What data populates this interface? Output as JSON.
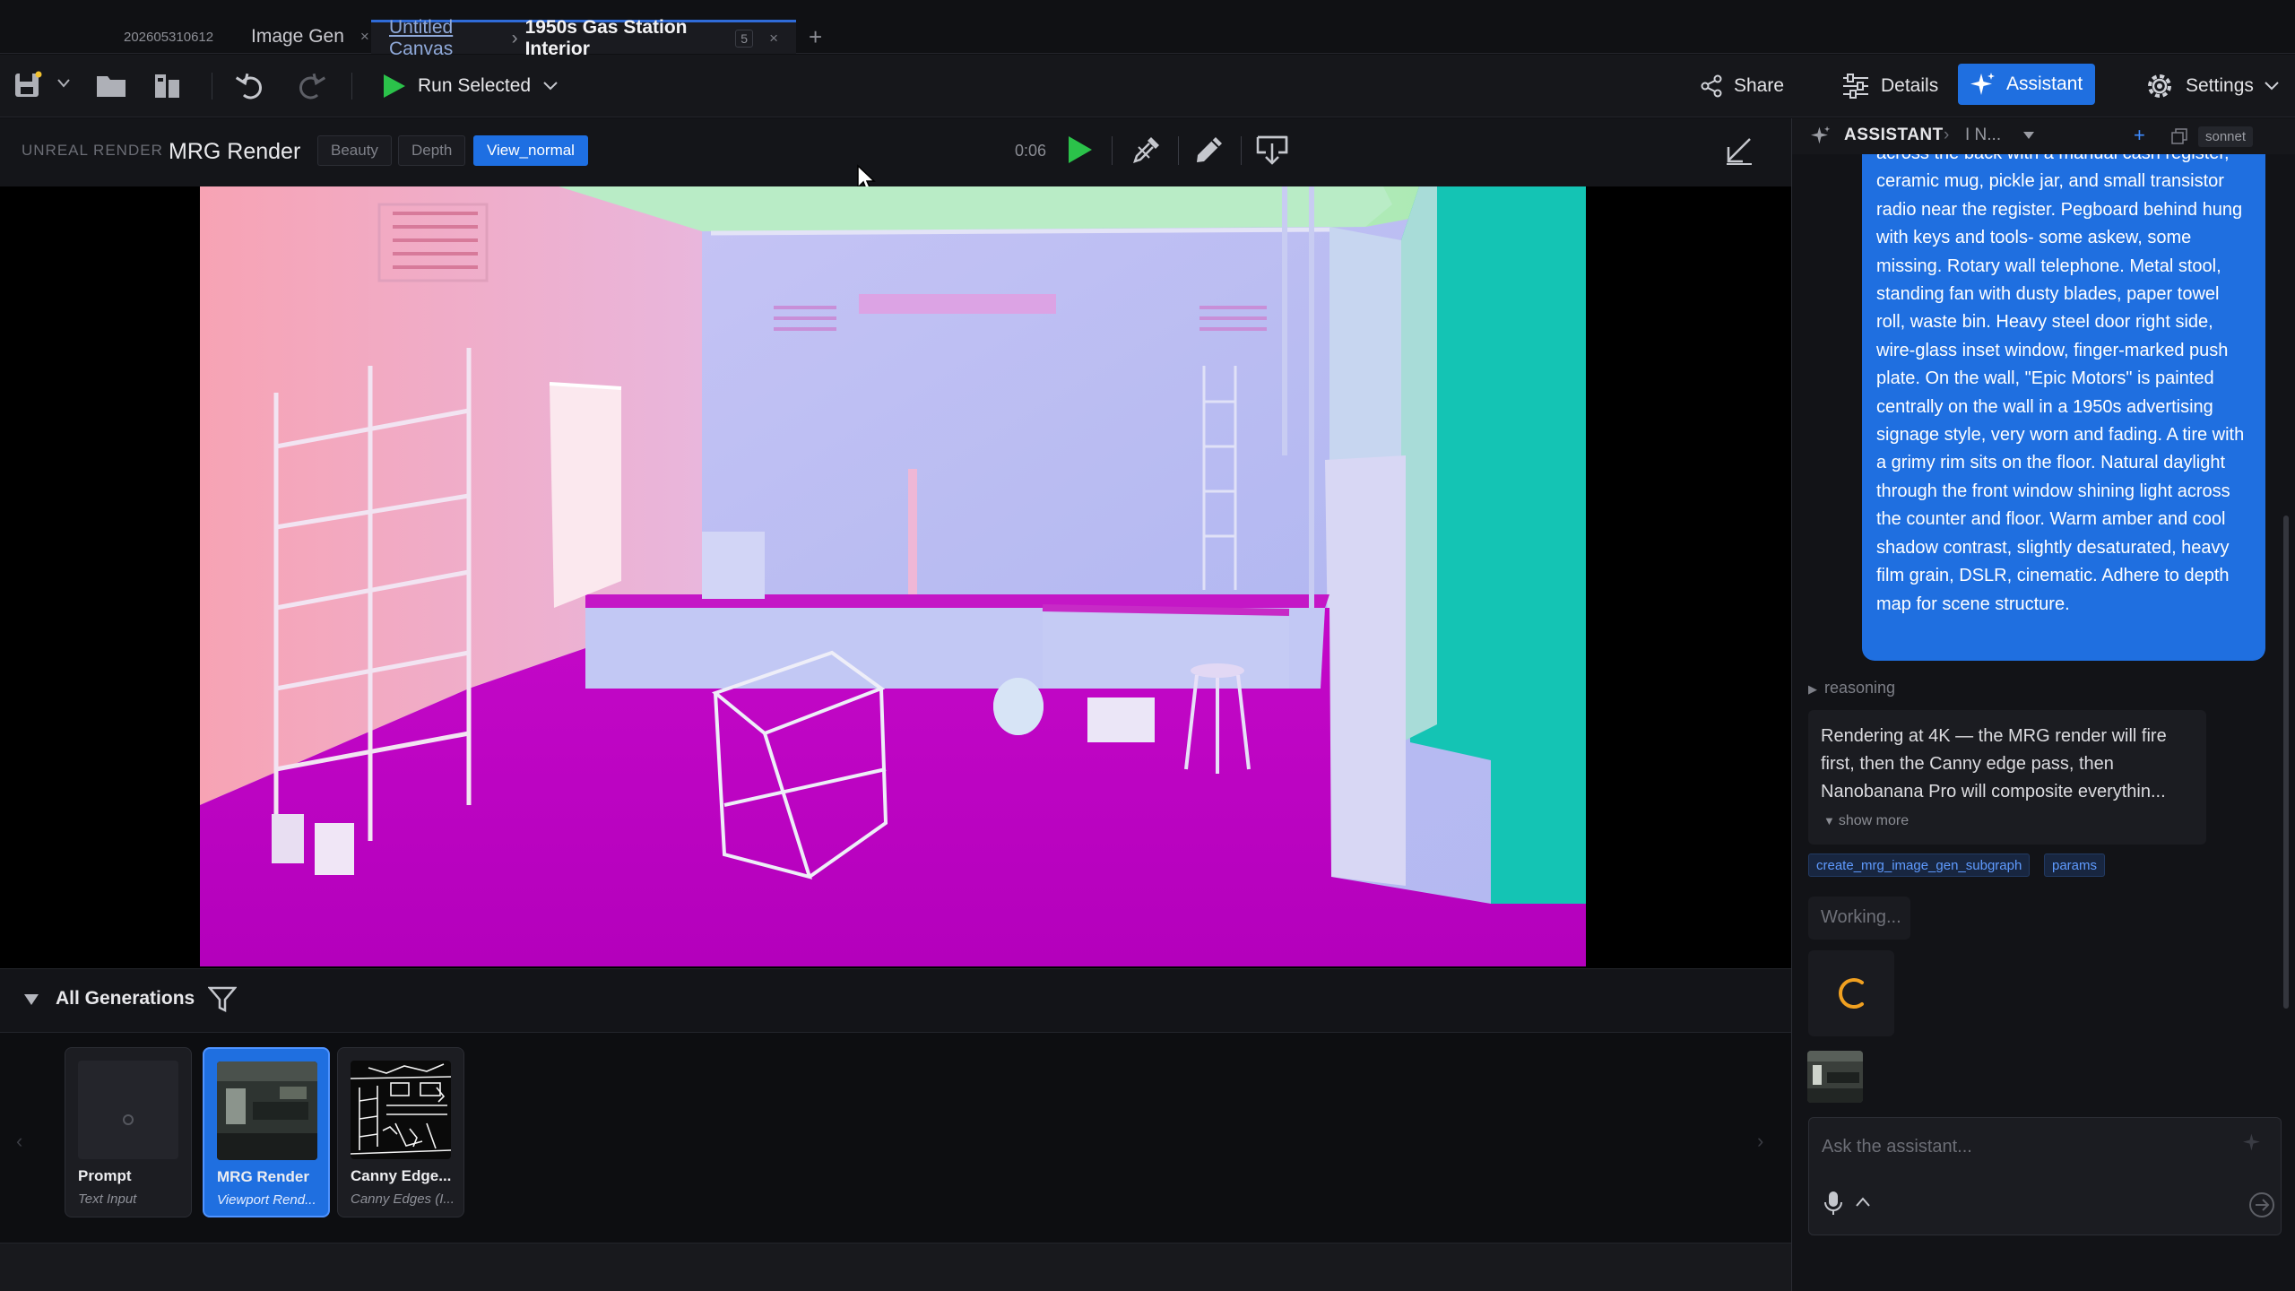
{
  "tabs": {
    "date": "202605310612",
    "image_gen": "Image Gen",
    "canvas_crumb": "Untitled Canvas",
    "canvas_title": "1950s Gas Station Interior",
    "canvas_badge": "5",
    "close": "×",
    "add": "+"
  },
  "toolbar": {
    "run_label": "Run Selected",
    "share_label": "Share",
    "details_label": "Details",
    "assistant_label": "Assistant",
    "settings_label": "Settings"
  },
  "render": {
    "source_label": "UNREAL RENDER",
    "title": "MRG Render",
    "passes": [
      "Beauty",
      "Depth",
      "View_normal"
    ],
    "active_pass": "View_normal",
    "time": "0:06"
  },
  "generations": {
    "title": "All Generations",
    "items": [
      {
        "name": "Prompt",
        "sub": "Text Input"
      },
      {
        "name": "MRG Render",
        "sub": "Viewport Rend..."
      },
      {
        "name": "Canny Edge...",
        "sub": "Canny Edges (I..."
      }
    ]
  },
  "assistant": {
    "title": "ASSISTANT",
    "model": "I N...",
    "model_badge": "sonnet",
    "user_message": "across the back with a manual cash register, ceramic mug, pickle jar, and small transistor radio near the register. Pegboard behind hung with keys and tools- some askew, some missing. Rotary wall telephone. Metal stool, standing fan with dusty blades, paper towel roll, waste bin. Heavy steel door right side, wire-glass inset window, finger-marked push plate. On the wall, \"Epic Motors\" is painted centrally on the wall in a 1950s advertising signage style, very worn and fading. A tire with a grimy rim sits on the floor. Natural daylight through the front window shining light across the counter and floor. Warm amber and cool shadow contrast, slightly desaturated, heavy film grain, DSLR, cinematic. Adhere to depth map for scene structure.",
    "reasoning_label": "reasoning",
    "reply": "Rendering at 4K — the MRG render will fire first, then the Canny edge pass, then Nanobanana Pro will composite everythin...",
    "show_more": "show more",
    "tool_chips": [
      "create_mrg_image_gen_subgraph",
      "params"
    ],
    "working": "Working...",
    "input_placeholder": "Ask the assistant..."
  },
  "colors": {
    "accent": "#1f6fe0",
    "run_green": "#2bc24a",
    "spinner": "#f0a020"
  }
}
